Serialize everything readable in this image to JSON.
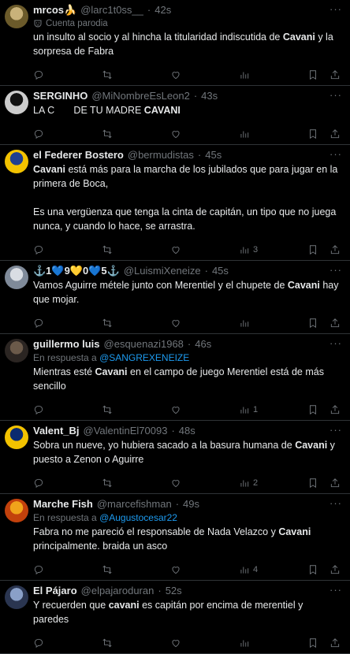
{
  "tweets": [
    {
      "name": "mrcos🍌",
      "handle": "@larc1t0ss__",
      "time": "42s",
      "parody_label": "Cuenta parodia",
      "reply_prefix": "",
      "reply_to": "",
      "paragraphs": [
        [
          {
            "t": "un insulto al socio y al hincha la titularidad indiscutida de "
          },
          {
            "t": "Cavani",
            "b": true
          },
          {
            "t": " y la sorpresa de Fabra"
          }
        ]
      ],
      "views": "",
      "avatar_colors": [
        "#c9b27a",
        "#6b5a2a"
      ]
    },
    {
      "name": "SERGINHO",
      "handle": "@MiNombreEsLeon2",
      "time": "43s",
      "parody_label": "",
      "reply_prefix": "",
      "reply_to": "",
      "paragraphs": [
        [
          {
            "t": "LA C"
          },
          {
            "t": "      "
          },
          {
            "t": " DE TU MADRE "
          },
          {
            "t": "CAVANI",
            "b": true
          }
        ]
      ],
      "views": "",
      "avatar_colors": [
        "#111111",
        "#cccccc"
      ]
    },
    {
      "name": "el Federer Bostero",
      "handle": "@bermudistas",
      "time": "45s",
      "parody_label": "",
      "reply_prefix": "",
      "reply_to": "",
      "paragraphs": [
        [
          {
            "t": "Cavani",
            "b": true
          },
          {
            "t": " está más para la marcha de los jubilados que para jugar en la primera de Boca,"
          }
        ],
        [
          {
            "t": "Es una vergüenza que tenga la cinta de capitán, un tipo que no juega nunca, y cuando lo hace, se arrastra."
          }
        ]
      ],
      "views": "3",
      "avatar_colors": [
        "#1f3f8f",
        "#f2c200"
      ]
    },
    {
      "name": "⚓1💙9💛0💙5⚓",
      "handle": "@LuismiXeneize",
      "time": "45s",
      "parody_label": "",
      "reply_prefix": "",
      "reply_to": "",
      "paragraphs": [
        [
          {
            "t": "Vamos Aguirre métele junto con Merentiel y el chupete de "
          },
          {
            "t": "Cavani",
            "b": true
          },
          {
            "t": " hay que mojar."
          }
        ]
      ],
      "views": "",
      "avatar_colors": [
        "#d9dde3",
        "#7f8a99"
      ]
    },
    {
      "name": "guillermo luis",
      "handle": "@esquenazi1968",
      "time": "46s",
      "parody_label": "",
      "reply_prefix": "En respuesta a",
      "reply_to": "@SANGREXENEIZE",
      "paragraphs": [
        [
          {
            "t": "Mientras esté "
          },
          {
            "t": "Cavani",
            "b": true
          },
          {
            "t": " en el campo de juego Merentiel está de más sencillo"
          }
        ]
      ],
      "views": "1",
      "avatar_colors": [
        "#6b5a4a",
        "#2b2522"
      ]
    },
    {
      "name": "Valent_Bj",
      "handle": "@ValentinEl70093",
      "time": "48s",
      "parody_label": "",
      "reply_prefix": "",
      "reply_to": "",
      "paragraphs": [
        [
          {
            "t": "Sobra un nueve, yo hubiera sacado a la basura humana de "
          },
          {
            "t": "Cavani",
            "b": true
          },
          {
            "t": " y puesto a Zenon o Aguirre"
          }
        ]
      ],
      "views": "2",
      "avatar_colors": [
        "#0b2a6f",
        "#f2c200"
      ]
    },
    {
      "name": "Marche Fish",
      "handle": "@marcefishman",
      "time": "49s",
      "parody_label": "",
      "reply_prefix": "En respuesta a",
      "reply_to": "@Augustocesar22",
      "paragraphs": [
        [
          {
            "t": "Fabra no me pareció el responsable de Nada Velazco y "
          },
          {
            "t": "Cavani",
            "b": true
          },
          {
            "t": " principalmente. braida un asco"
          }
        ]
      ],
      "views": "4",
      "avatar_colors": [
        "#f0a41b",
        "#c2410c"
      ]
    },
    {
      "name": "El Pájaro",
      "handle": "@elpajaroduran",
      "time": "52s",
      "parody_label": "",
      "reply_prefix": "",
      "reply_to": "",
      "paragraphs": [
        [
          {
            "t": "Y recuerden que "
          },
          {
            "t": "cavani",
            "b": true
          },
          {
            "t": " es capitán por encima de merentiel y paredes"
          }
        ]
      ],
      "views": "",
      "avatar_colors": [
        "#8aa0c8",
        "#2a3550"
      ]
    }
  ],
  "icons": {
    "reply": "reply-icon",
    "retweet": "retweet-icon",
    "like": "like-icon",
    "views": "views-icon",
    "bookmark": "bookmark-icon",
    "share": "share-icon",
    "more": "more-icon",
    "parody": "parody-icon"
  },
  "colors": {
    "background": "#000000",
    "text": "#e7e9ea",
    "muted": "#71767b",
    "link": "#1d9bf0",
    "divider": "#2f3336"
  },
  "more_glyph": "···"
}
